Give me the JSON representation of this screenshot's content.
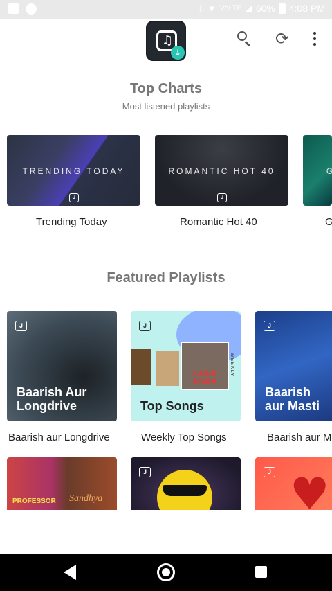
{
  "status_bar": {
    "volte": "VoLTE",
    "battery": "60%",
    "time": "4:08 PM"
  },
  "header": {
    "logo_icon": "music-note-download-icon",
    "actions": [
      "search-icon",
      "sync-icon",
      "more-vert-icon"
    ]
  },
  "top_charts": {
    "title": "Top Charts",
    "subtitle": "Most listened playlists",
    "items": [
      {
        "card_text": "TRENDING TODAY",
        "label": "Trending Today"
      },
      {
        "card_text": "ROMANTIC HOT 40",
        "label": "Romantic Hot 40"
      },
      {
        "card_text": "G",
        "label": "G"
      }
    ]
  },
  "featured": {
    "title": "Featured Playlists",
    "items": [
      {
        "overlay_line1": "Baarish Aur",
        "overlay_line2": "Longdrive",
        "label": "Baarish aur Longdrive"
      },
      {
        "overlay_line1": "Top Songs",
        "overlay_line2": "",
        "side_text": "WEEKLY",
        "poster_text": "KABIR SINGH",
        "label": "Weekly Top Songs"
      },
      {
        "overlay_line1": "Baarish",
        "overlay_line2": "aur Masti",
        "label": "Baarish aur M"
      }
    ],
    "row2": [
      {
        "poster_text_1": "PROFESSOR",
        "poster_text_2": "Sandhya"
      },
      {
        "icon": "sunglasses-emoji-icon"
      },
      {
        "icon": "heart-icon"
      }
    ]
  },
  "jio_badge": "J",
  "nav": [
    "back-icon",
    "home-icon",
    "recents-icon"
  ]
}
